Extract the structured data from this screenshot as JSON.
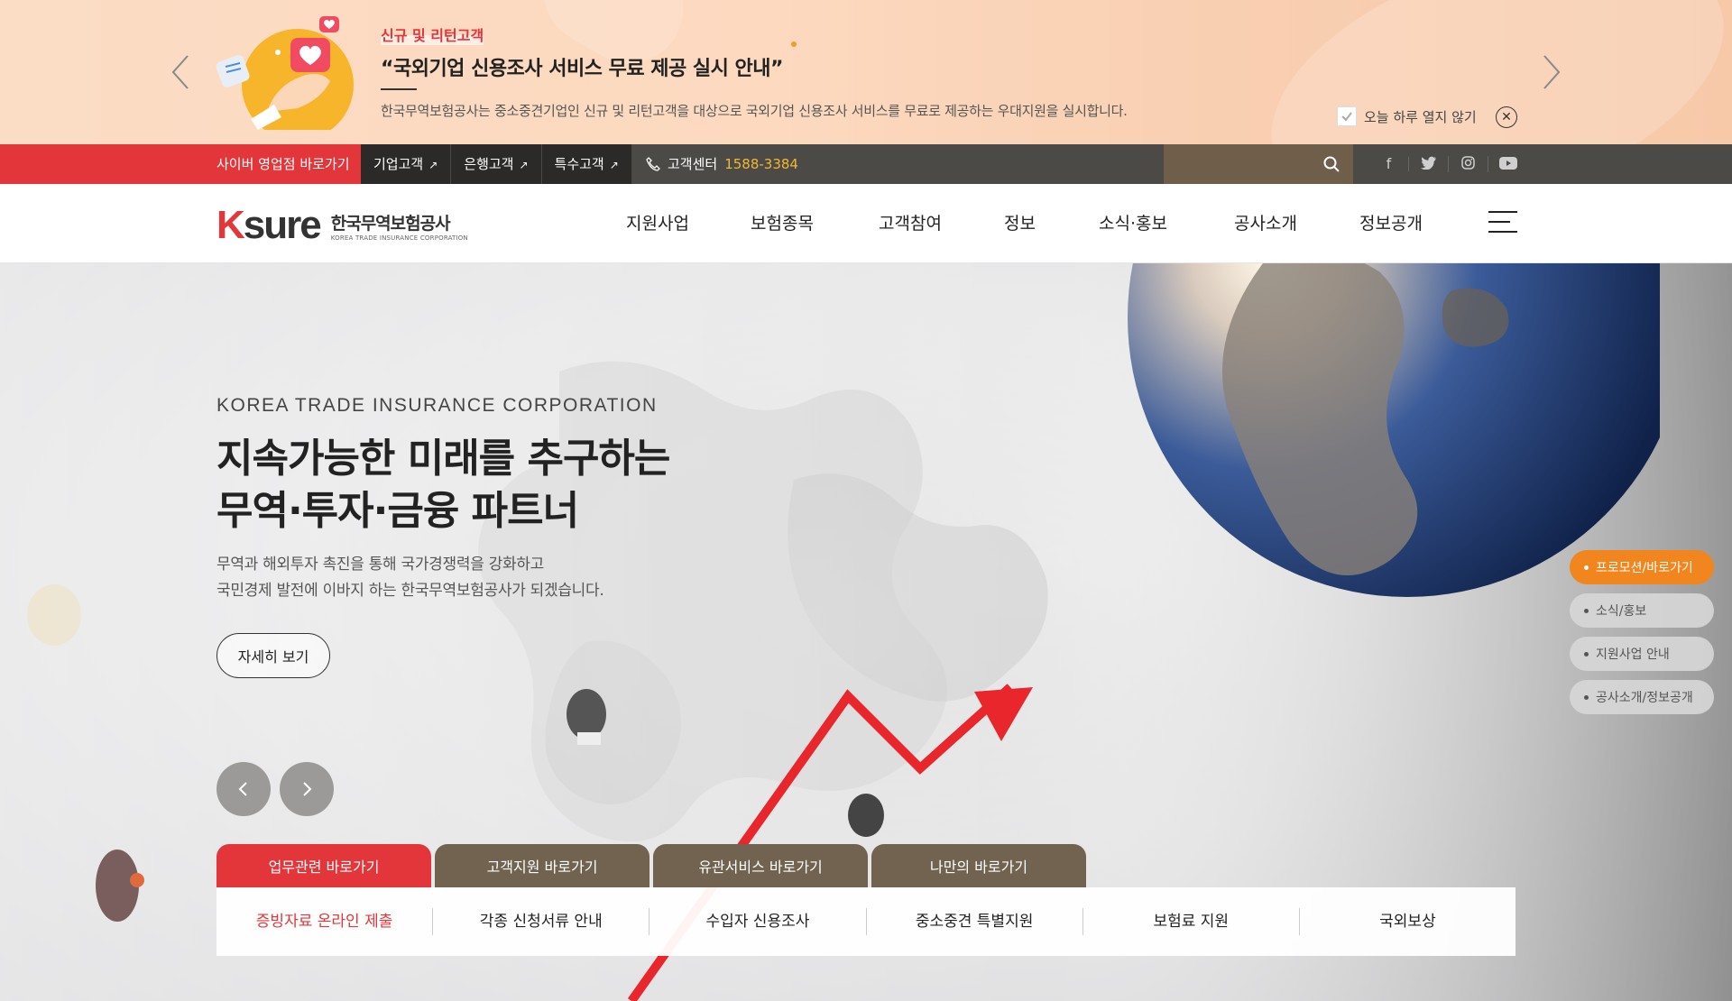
{
  "colors": {
    "brand_red": "#e3363b",
    "accent_orange": "#f0861d",
    "tab_brown": "#726350",
    "util_dark": "#4c4a47"
  },
  "promo": {
    "tag": "신규 및 리턴고객",
    "headline": "“국외기업 신용조사 서비스 무료 제공 실시 안내”",
    "description": "한국무역보험공사는 중소중견기업인 신규 및 리턴고객을 대상으로 국외기업 신용조사 서비스를 무료로 제공하는 우대지원을 실시합니다.",
    "no_show_today": "오늘 하루 열지 않기"
  },
  "util": {
    "cyber": "사이버 영업점 바로가기",
    "tabs": [
      {
        "label": "기업고객"
      },
      {
        "label": "은행고객"
      },
      {
        "label": "특수고객"
      }
    ],
    "ext_mark": "↗",
    "call_center_label": "고객센터",
    "call_center_number": "1588-3384"
  },
  "header": {
    "logo_mark": "sure",
    "logo_k": "K",
    "logo_ko": "한국무역보험공사",
    "logo_en": "KOREA TRADE INSURANCE CORPORATION",
    "gnb": [
      "지원사업",
      "보험종목",
      "고객참여",
      "정보",
      "소식·홍보",
      "공사소개",
      "정보공개"
    ]
  },
  "hero": {
    "eyebrow": "KOREA TRADE INSURANCE CORPORATION",
    "title_line1": "지속가능한 미래를 추구하는",
    "title_line2": "무역·투자·금융 파트너",
    "sub_line1": "무역과 해외투자 촉진을 통해 국가경쟁력을 강화하고",
    "sub_line2": "국민경제 발전에 이바지 하는 한국무역보험공사가 되겠습니다.",
    "more_button": "자세히 보기"
  },
  "quick_nav": [
    "프로모션/바로가기",
    "소식/홍보",
    "지원사업 안내",
    "공사소개/정보공개"
  ],
  "quick_tabs": [
    "업무관련 바로가기",
    "고객지원 바로가기",
    "유관서비스 바로가기",
    "나만의 바로가기"
  ],
  "quick_links": [
    "증빙자료 온라인 제출",
    "각종 신청서류 안내",
    "수입자 신용조사",
    "중소중견 특별지원",
    "보험료 지원",
    "국외보상"
  ]
}
